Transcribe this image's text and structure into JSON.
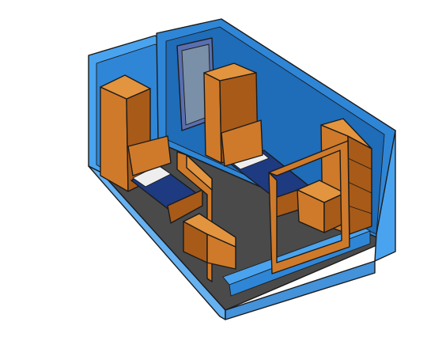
{
  "scene": {
    "kind": "isometric-dorm-room-model",
    "furniture_count": {
      "beds": 2,
      "wardrobes": 2,
      "desks": 2,
      "bookshelves": 1,
      "mirrors": 1,
      "door": 1
    }
  },
  "colors": {
    "wall": "#2f86d6",
    "wall_dark": "#1f6cb8",
    "wall_light": "#4aa3ee",
    "floor": "#4a4a4a",
    "wood": "#cf7a2a",
    "wood_dark": "#a85a18",
    "wood_light": "#e3943e",
    "mattress": "#1e3a80",
    "pillow": "#eeeeee",
    "door_frame": "#5a6fb0",
    "door_panel": "#7a8fa8",
    "outline": "#1b1b1b",
    "background": "#ffffff"
  }
}
